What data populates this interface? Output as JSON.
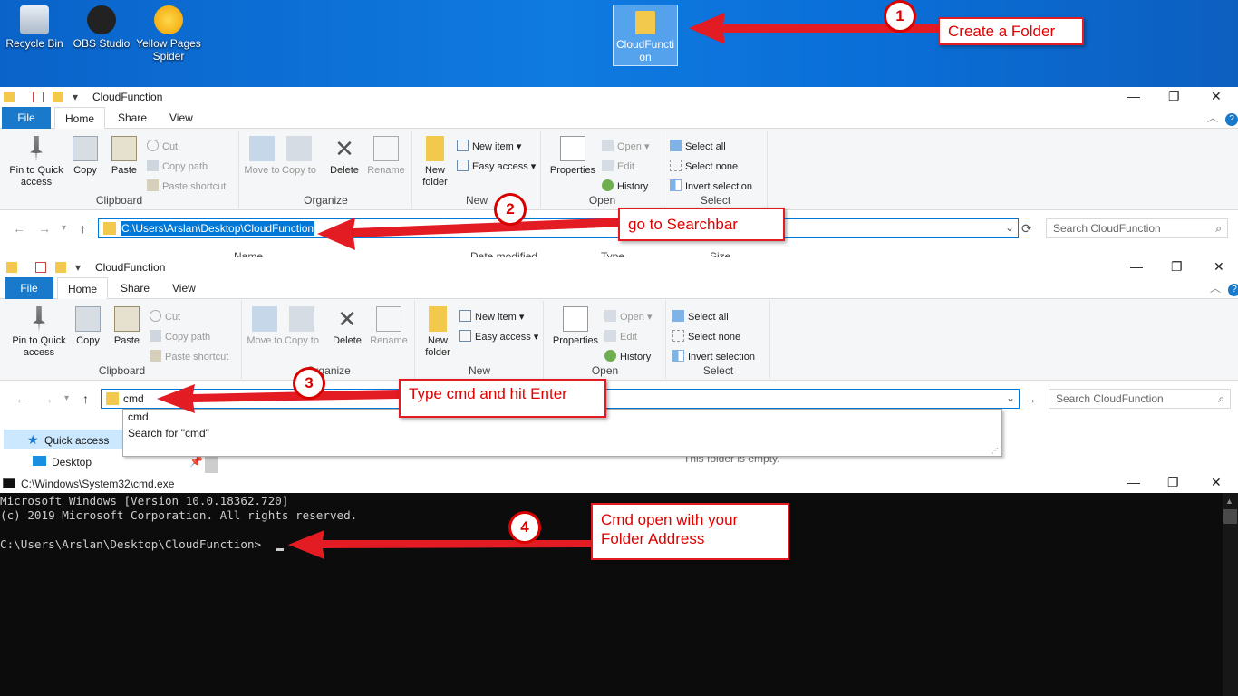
{
  "desktop": {
    "icons": [
      {
        "label": "Recycle Bin"
      },
      {
        "label": "OBS Studio"
      },
      {
        "label": "Yellow Pages Spider"
      }
    ],
    "selected_folder": "CloudFunction"
  },
  "explorer": {
    "title": "CloudFunction",
    "tabs": [
      "File",
      "Home",
      "Share",
      "View"
    ],
    "clipboard": {
      "pin": "Pin to Quick access",
      "copy": "Copy",
      "paste": "Paste",
      "cut": "Cut",
      "copy_path": "Copy path",
      "paste_shortcut": "Paste shortcut",
      "label": "Clipboard"
    },
    "organize": {
      "move": "Move to",
      "copy": "Copy to",
      "delete": "Delete",
      "rename": "Rename",
      "label": "Organize"
    },
    "new": {
      "new_folder": "New folder",
      "new_item": "New item",
      "easy_access": "Easy access",
      "label": "New"
    },
    "open": {
      "properties": "Properties",
      "open": "Open",
      "edit": "Edit",
      "history": "History",
      "label": "Open"
    },
    "select": {
      "all": "Select all",
      "none": "Select none",
      "invert": "Invert selection",
      "label": "Select"
    },
    "columns": {
      "name": "Name",
      "date": "Date modified",
      "type": "Type",
      "size": "Size"
    },
    "address1": "C:\\Users\\Arslan\\Desktop\\CloudFunction",
    "address2": "cmd",
    "search_placeholder": "Search CloudFunction",
    "suggestions": [
      "cmd",
      "Search for \"cmd\""
    ],
    "nav_quick_access": "Quick access",
    "nav_desktop": "Desktop",
    "empty": "This folder is empty."
  },
  "cmd": {
    "title": "C:\\Windows\\System32\\cmd.exe",
    "lines": [
      "Microsoft Windows [Version 10.0.18362.720]",
      "(c) 2019 Microsoft Corporation. All rights reserved.",
      "",
      "C:\\Users\\Arslan\\Desktop\\CloudFunction>"
    ]
  },
  "callouts": {
    "c1": "Create a Folder",
    "c2": "go to Searchbar",
    "c3": "Type cmd and hit Enter",
    "c4a": "Cmd open with your",
    "c4b": "Folder Address",
    "n1": "1",
    "n2": "2",
    "n3": "3",
    "n4": "4"
  },
  "colors": {
    "accent": "#1979ca",
    "callout": "#e31b23"
  }
}
